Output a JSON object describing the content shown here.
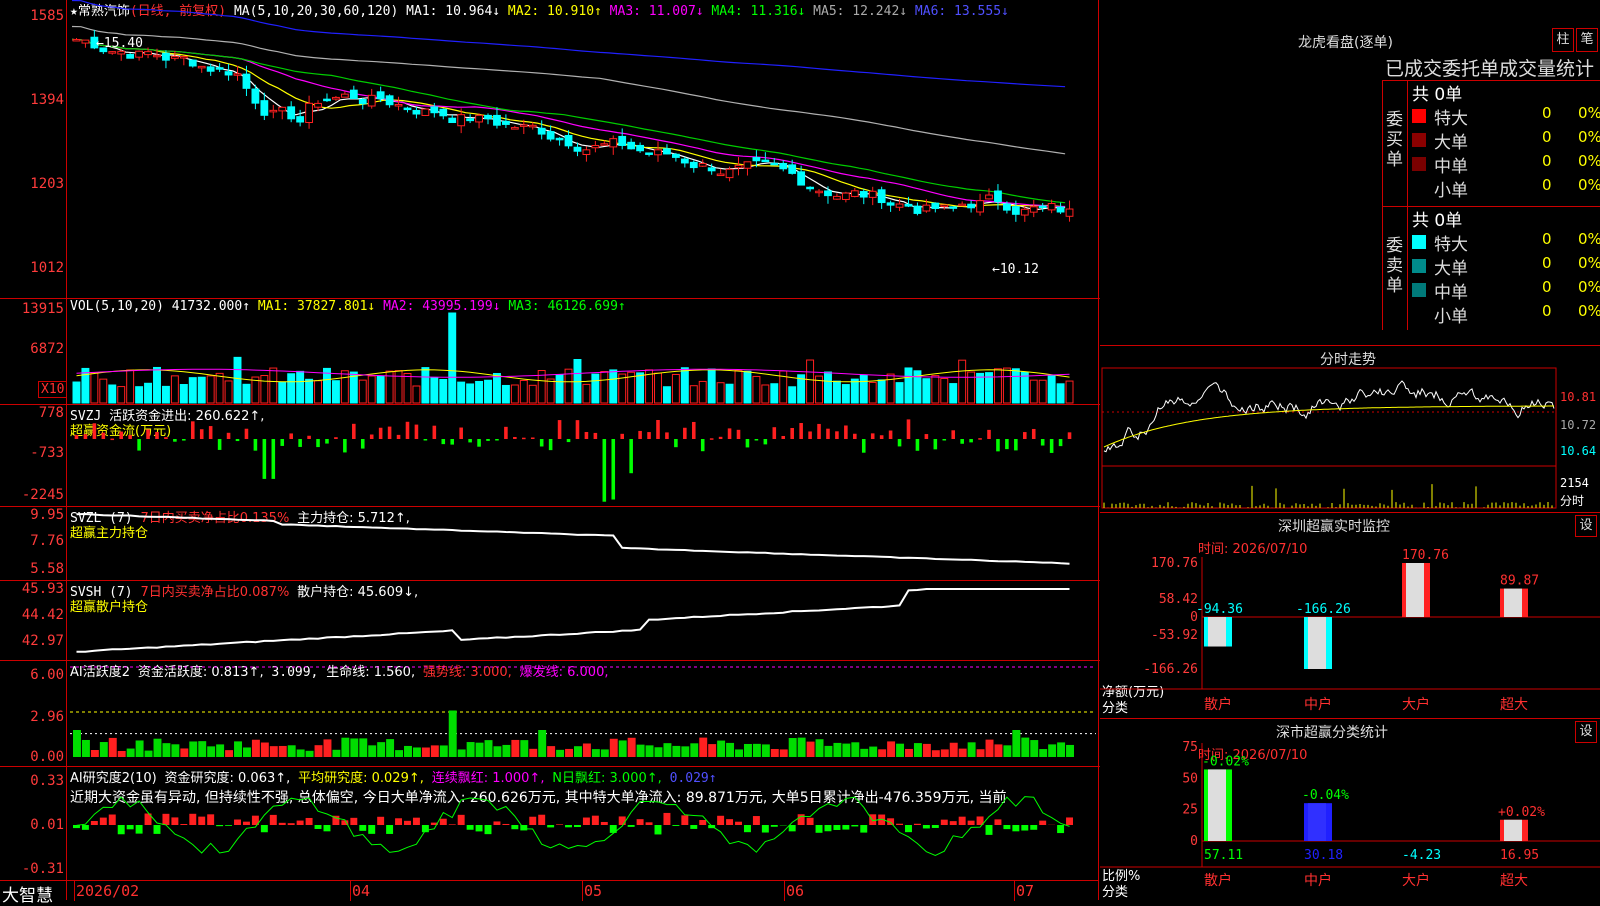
{
  "stock": {
    "name": "★常熟汽饰",
    "mode": "(日线, 前复权)",
    "ma_header": "MA(5,10,20,30,60,120)",
    "ma1": "MA1: 10.964↓",
    "ma2": "MA2: 10.910↑",
    "ma3": "MA3: 11.007↓",
    "ma4": "MA4: 11.316↓",
    "ma5": "MA5: 12.242↓",
    "ma6": "MA6: 13.555↓",
    "price_axis": [
      "1585",
      "1394",
      "1203",
      "1012"
    ],
    "high_label": "←15.40",
    "low_label": "←10.12",
    "colors": {
      "up": "#ff2020",
      "down": "#00ffff",
      "ma1": "#ffffff",
      "ma2": "#ffff00",
      "ma3": "#ff00ff",
      "ma4": "#00cc00",
      "ma5": "#b0b0b0",
      "ma6": "#2020ff"
    }
  },
  "vol": {
    "header": "VOL(5,10,20)",
    "value": "41732.000↑",
    "ma1": "MA1: 37827.801↓",
    "ma2": "MA2: 43995.199↓",
    "ma3": "MA3: 46126.699↑",
    "axis": [
      "13915",
      "6872"
    ],
    "unit": "X10"
  },
  "svzj": {
    "header": "SVZJ",
    "label": "活跃资金进出: 260.622↑,",
    "sub": "超赢资金流(万元)",
    "axis": [
      "778",
      "-733",
      "-2245"
    ]
  },
  "svzl": {
    "header": "SVZL (7)",
    "ratio": "7日内买卖净占比0.135%",
    "hold": "主力持仓: 5.712↑,",
    "sub": "超赢主力持仓",
    "axis": [
      "9.95",
      "7.76",
      "5.58"
    ]
  },
  "svsh": {
    "header": "SVSH (7)",
    "ratio": "7日内买卖净占比0.087%",
    "hold": "散户持仓: 45.609↓,",
    "sub": "超赢散户持仓",
    "axis": [
      "45.93",
      "44.42",
      "42.97"
    ]
  },
  "ai1": {
    "header": "AI活跃度2",
    "a": "资金活跃度: 0.813↑,",
    "b": "3.099,",
    "c": "生命线: 1.560,",
    "d": "强势线: 3.000,",
    "e": "爆发线: 6.000,",
    "axis": [
      "6.00",
      "2.96",
      "0.00"
    ]
  },
  "ai2": {
    "header": "AI研究度2(10)",
    "a": "资金研究度: 0.063↑,",
    "b": "平均研究度: 0.029↑,",
    "c": "连续飘红: 1.000↑,",
    "d": "N日飘红: 3.000↑,",
    "e": "0.029↑",
    "comment": "近期大资金虽有异动, 但持续性不强, 总体偏空, 今日大单净流入: 260.626万元, 其中特大单净流入: 89.871万元, 大单5日累计净出-476.359万元, 当前",
    "axis": [
      "0.33",
      "0.01",
      "-0.31"
    ]
  },
  "xaxis": {
    "brand": "大智慧",
    "labels": [
      "2026/02",
      "04",
      "05",
      "06",
      "07"
    ]
  },
  "right": {
    "lhb_title": "龙虎看盘(逐单)",
    "tab_bar": "柱",
    "tab_pen": "笔",
    "stat_title": "已成交委托单成交量统计",
    "buy_side": "委买单",
    "sell_side": "委卖单",
    "buy_total": "共 0单",
    "sell_total": "共 0单",
    "rows": [
      {
        "name": "特大",
        "count": "0",
        "pct": "0%"
      },
      {
        "name": "大单",
        "count": "0",
        "pct": "0%"
      },
      {
        "name": "中单",
        "count": "0",
        "pct": "0%"
      },
      {
        "name": "小单",
        "count": "0",
        "pct": "0%"
      }
    ],
    "buy_colors": [
      "#ff0000",
      "#8b0000",
      "#7a0000",
      "#000000"
    ],
    "sell_colors": [
      "#00ffff",
      "#008b8b",
      "#007a7a",
      "#000000"
    ],
    "intraday_title": "分时走势",
    "intraday_axis": [
      "10.81",
      "10.72",
      "10.64"
    ],
    "intraday_vol": "2154",
    "intraday_vol_unit": "分时",
    "monitor_title": "深圳超赢实时监控",
    "set_label": "设",
    "monitor_time": "时间: 2026/07/10",
    "monitor_axis": [
      "170.76",
      "58.42",
      "0",
      "-53.92",
      "-166.26"
    ],
    "monitor_ylabel": "净额(万元)",
    "monitor_xlabel": "分类",
    "monitor_cats": [
      "散户",
      "中户",
      "大户",
      "超大"
    ],
    "monitor_values": [
      "-94.36",
      "-166.26",
      "170.76",
      "89.87"
    ],
    "class_title": "深市超赢分类统计",
    "class_time": "时间: 2026/07/10",
    "class_axis": [
      "75",
      "50",
      "25",
      "0"
    ],
    "class_ylabel": "比例%",
    "class_xlabel": "分类",
    "class_top": [
      "-0.02%",
      "-0.04%",
      "",
      "+0.02%"
    ],
    "class_bottom": [
      "57.11",
      "30.18",
      "-4.23",
      "16.95"
    ]
  },
  "chart_data": [
    {
      "type": "line",
      "title": "MA",
      "ylim": [
        10.12,
        15.85
      ],
      "series": [
        {
          "name": "MA1"
        },
        {
          "name": "MA2"
        },
        {
          "name": "MA3"
        },
        {
          "name": "MA4"
        },
        {
          "name": "MA5"
        },
        {
          "name": "MA6"
        }
      ]
    },
    {
      "type": "bar",
      "title": "VOL",
      "ylim": [
        0,
        13915
      ]
    },
    {
      "type": "bar",
      "title": "SVZJ",
      "ylim": [
        -2245,
        778
      ]
    },
    {
      "type": "bar",
      "title": "monitor",
      "categories": [
        "散户",
        "中户",
        "大户",
        "超大"
      ],
      "values": [
        -94.36,
        -166.26,
        170.76,
        89.87
      ],
      "ylim": [
        -166.26,
        170.76
      ]
    },
    {
      "type": "bar",
      "title": "class",
      "categories": [
        "散户",
        "中户",
        "大户",
        "超大"
      ],
      "values": [
        57.11,
        30.18,
        -4.23,
        16.95
      ],
      "ylim": [
        0,
        75
      ]
    }
  ]
}
